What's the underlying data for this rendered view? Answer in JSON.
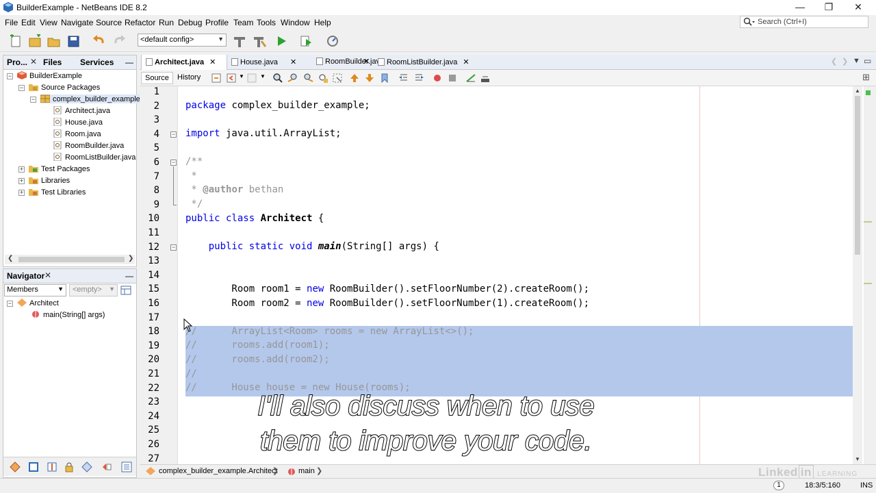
{
  "window": {
    "title": "BuilderExample - NetBeans IDE 8.2",
    "controls": [
      "—",
      "❐",
      "✕"
    ]
  },
  "menu": [
    "File",
    "Edit",
    "View",
    "Navigate",
    "Source",
    "Refactor",
    "Run",
    "Debug",
    "Profile",
    "Team",
    "Tools",
    "Window",
    "Help"
  ],
  "search": {
    "placeholder": "Search (Ctrl+I)"
  },
  "toolbar": {
    "config": "<default config>"
  },
  "projects_panel": {
    "tabs": [
      "Pro...",
      "Files",
      "Services"
    ],
    "tree": [
      {
        "label": "BuilderExample",
        "icon": "project-icon"
      },
      {
        "label": "Source Packages",
        "icon": "package-folder-icon"
      },
      {
        "label": "complex_builder_example",
        "icon": "package-icon"
      },
      {
        "label": "Architect.java",
        "icon": "java-file-icon"
      },
      {
        "label": "House.java",
        "icon": "java-file-icon"
      },
      {
        "label": "Room.java",
        "icon": "java-file-icon"
      },
      {
        "label": "RoomBuilder.java",
        "icon": "java-file-icon"
      },
      {
        "label": "RoomListBuilder.java",
        "icon": "java-file-icon"
      },
      {
        "label": "Test Packages",
        "icon": "package-folder-icon"
      },
      {
        "label": "Libraries",
        "icon": "library-icon"
      },
      {
        "label": "Test Libraries",
        "icon": "library-icon"
      }
    ]
  },
  "navigator": {
    "title": "Navigator",
    "filter": "Members",
    "empty": "<empty>",
    "tree": [
      {
        "label": "Architect",
        "icon": "class-icon"
      },
      {
        "label": "main(String[] args)",
        "icon": "method-icon"
      }
    ]
  },
  "editor": {
    "tabs": [
      "Architect.java",
      "House.java",
      "RoomBuilder.java",
      "RoomListBuilder.java"
    ],
    "active_tab": "Architect.java",
    "modes": [
      "Source",
      "History"
    ],
    "lines": [
      "1",
      "2",
      "3",
      "4",
      "5",
      "6",
      "7",
      "8",
      "9",
      "10",
      "11",
      "12",
      "13",
      "14",
      "15",
      "16",
      "17",
      "18",
      "19",
      "20",
      "21",
      "22",
      "23",
      "24",
      "25",
      "26",
      "27"
    ],
    "code": {
      "l2_kw": "package",
      "l2_rest": " complex_builder_example;",
      "l4_kw": "import",
      "l4_rest": " java.util.ArrayList;",
      "l6": "/**",
      "l7": " *",
      "l8_star": " * ",
      "l8_tag": "@author",
      "l8_name": " bethan",
      "l9": " */",
      "l10_kw": "public class",
      "l10_name": " Architect",
      "l10_rest": " {",
      "l12_kw": "    public static void",
      "l12_name": " main",
      "l12_rest": "(String[] args) {",
      "l15_a": "        Room room1 = ",
      "l15_kw": "new",
      "l15_b": " RoomBuilder().setFloorNumber(2).createRoom();",
      "l16_a": "        Room room2 = ",
      "l16_kw": "new",
      "l16_b": " RoomBuilder().setFloorNumber(1).createRoom();",
      "l18": "//      ArrayList<Room> rooms = new ArrayList<>();",
      "l19": "//      rooms.add(room1);",
      "l20": "//      rooms.add(room2);",
      "l21": "//",
      "l22": "//      House house = new House(rooms);"
    }
  },
  "breadcrumb": {
    "class": "complex_builder_example.Architect",
    "method": "main"
  },
  "status": {
    "notifications": "1",
    "position": "18:3/5:160",
    "mode": "INS"
  },
  "subtitle": {
    "line1": "I'll also discuss when to use",
    "line2": "them to improve your code."
  },
  "watermark": {
    "brand": "Linked",
    "brand_in": "in",
    "sub": "LEARNING"
  }
}
